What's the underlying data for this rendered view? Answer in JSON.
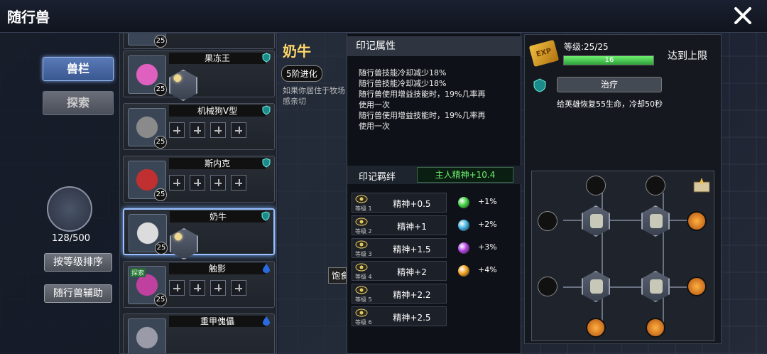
{
  "header": {
    "title": "随行兽"
  },
  "left": {
    "tabs": [
      "兽栏",
      "探索"
    ],
    "count": "128/500",
    "sort_label": "按等级排序",
    "assist_label": "随行兽辅助"
  },
  "pets": [
    {
      "name": "果冻王",
      "level": "25",
      "slots": [
        "gem",
        "gem",
        "gem",
        "gem"
      ],
      "icon": "shield-icon",
      "color": "#e060c0"
    },
    {
      "name": "机械狗V型",
      "level": "25",
      "slots": [
        "plus",
        "plus",
        "plus",
        "plus"
      ],
      "icon": "shield-icon",
      "color": "#8a8a8a"
    },
    {
      "name": "斯内克",
      "level": "25",
      "slots": [
        "plus",
        "plus",
        "plus",
        "plus"
      ],
      "icon": "shield-icon",
      "color": "#c03030"
    },
    {
      "name": "奶牛",
      "level": "25",
      "slots": [
        "gem",
        "gem",
        "gem",
        "gem"
      ],
      "icon": "shield-icon",
      "color": "#dcdcdc",
      "selected": true
    },
    {
      "name": "触影",
      "level": "25",
      "slots": [
        "plus",
        "plus",
        "plus",
        "plus"
      ],
      "icon": "drop-icon",
      "tag": "探索",
      "color": "#c040a0"
    },
    {
      "name": "重甲傀儡",
      "level": "",
      "slots": [],
      "icon": "drop-icon",
      "color": "#9a9aa8"
    }
  ],
  "top_partial": {
    "level": "25"
  },
  "detail": {
    "name": "奶牛",
    "evolution": "5阶进化",
    "desc_lines": [
      "如果你居住于牧场",
      "感亲切"
    ],
    "feed_label": "饱食"
  },
  "popup": {
    "title": "印记属性",
    "text_lines": [
      "随行兽技能冷却减少18%",
      "随行兽技能冷却减少18%",
      "随行兽使用增益技能时，19%几率再",
      "使用一次",
      "随行兽使用增益技能时，19%几率再",
      "使用一次"
    ],
    "bond_label": "印记羁绊",
    "bond_value": "主人精神+10.4",
    "levels": [
      {
        "lvl": "等级 1",
        "stat": "精神+0.5"
      },
      {
        "lvl": "等级 2",
        "stat": "精神+1"
      },
      {
        "lvl": "等级 3",
        "stat": "精神+1.5"
      },
      {
        "lvl": "等级 4",
        "stat": "精神+2"
      },
      {
        "lvl": "等级 5",
        "stat": "精神+2.2"
      },
      {
        "lvl": "等级 6",
        "stat": "精神+2.5"
      }
    ],
    "orbs": [
      {
        "val": "+1%",
        "color": "#40d040"
      },
      {
        "val": "+2%",
        "color": "#40b0e0"
      },
      {
        "val": "+3%",
        "color": "#b040e0"
      },
      {
        "val": "+4%",
        "color": "#f0a020"
      }
    ]
  },
  "right": {
    "exp_badge": "EXP",
    "level_text": "等级:25/25",
    "exp_value": "16",
    "exp_fraction": 1.0,
    "max_text": "达到上限",
    "skill_name": "治疗",
    "skill_desc": "给英雄恢复55生命，冷却50秒"
  }
}
